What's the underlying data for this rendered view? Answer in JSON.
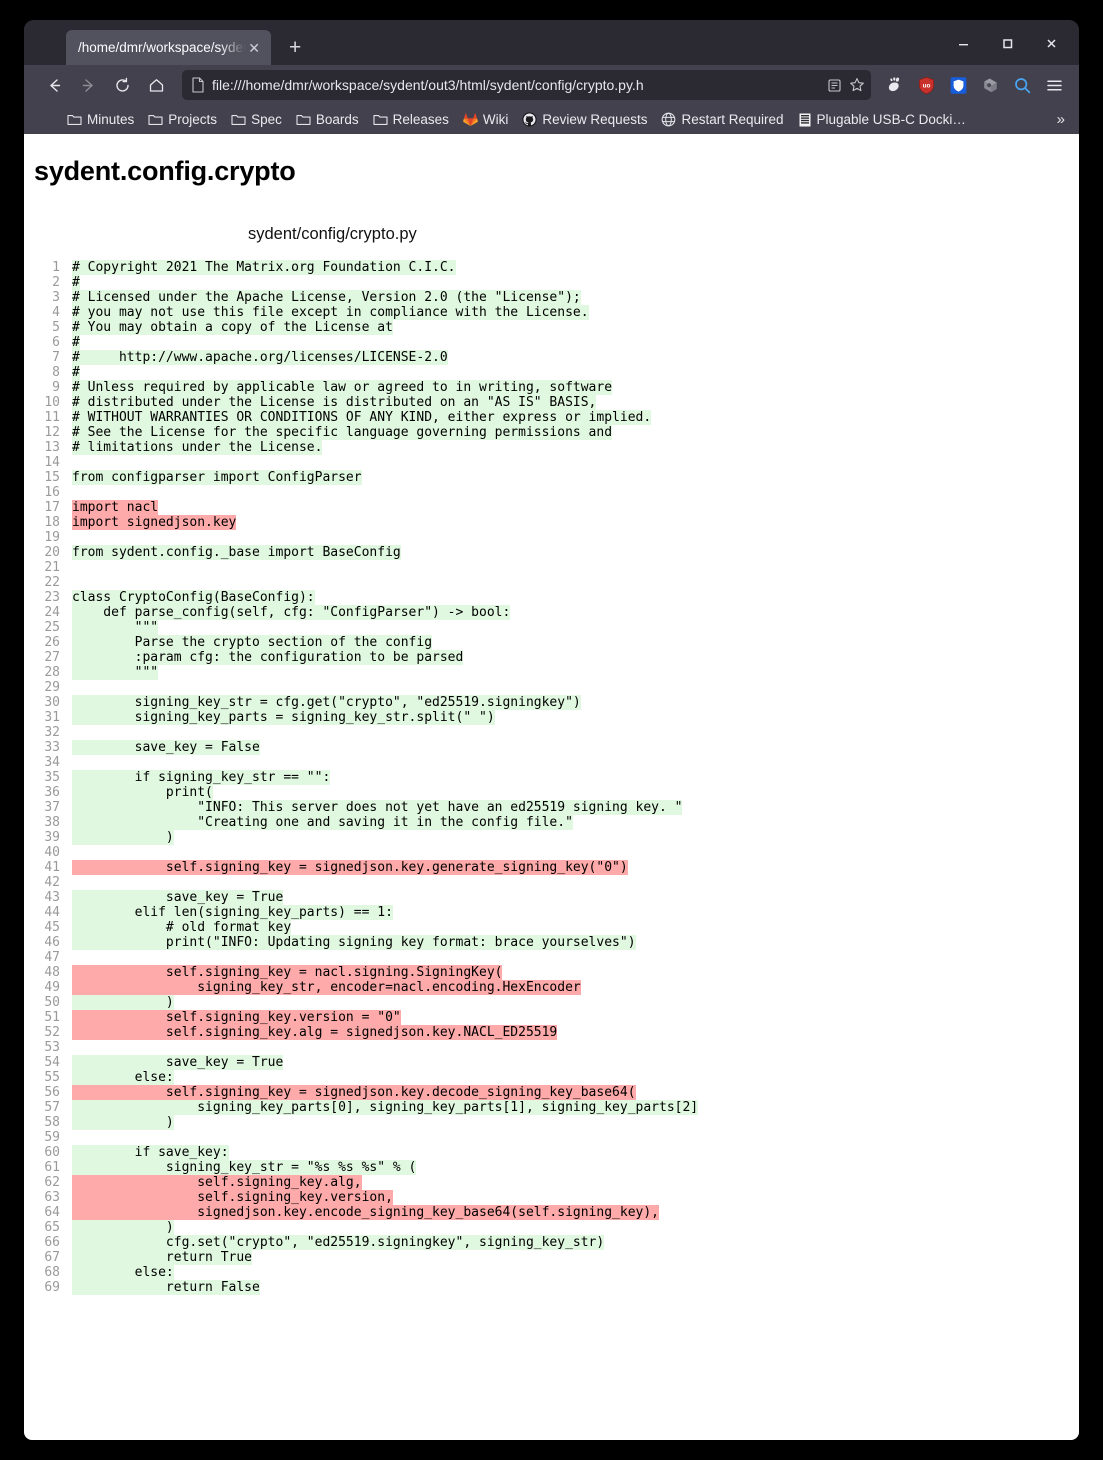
{
  "window": {
    "controls": {
      "minimize": "minimize",
      "maximize": "maximize",
      "close": "close"
    }
  },
  "tabs": [
    {
      "title": "/home/dmr/workspace/syden",
      "close_label": "✕",
      "active": true
    }
  ],
  "new_tab_label": "+",
  "toolbar": {
    "back_label": "back",
    "forward_label": "forward",
    "reload_label": "reload",
    "home_label": "home",
    "url": "file:///home/dmr/workspace/sydent/out3/html/sydent/config/crypto.py.h",
    "reader_label": "reader-view",
    "bookmark_label": "bookmark",
    "extensions": [
      "gnome-icon",
      "ublock-origin-icon",
      "bitwarden-icon",
      "extension-icon"
    ],
    "search_label": "search",
    "menu_label": "menu"
  },
  "bookmarks": {
    "items": [
      {
        "label": "Minutes",
        "icon": "folder-icon"
      },
      {
        "label": "Projects",
        "icon": "folder-icon"
      },
      {
        "label": "Spec",
        "icon": "folder-icon"
      },
      {
        "label": "Boards",
        "icon": "folder-icon"
      },
      {
        "label": "Releases",
        "icon": "folder-icon"
      },
      {
        "label": "Wiki",
        "icon": "gitlab-icon"
      },
      {
        "label": "Review Requests",
        "icon": "github-icon"
      },
      {
        "label": "Restart Required",
        "icon": "globe-icon"
      },
      {
        "label": "Plugable USB-C Docki…",
        "icon": "favicon-icon"
      }
    ],
    "overflow_label": "»"
  },
  "page": {
    "title": "sydent.config.crypto",
    "file_path": "sydent/config/crypto.py",
    "colors": {
      "covered": "#e0f8e0",
      "uncovered": "#ffaaaa"
    },
    "lines": [
      {
        "n": 1,
        "hl": "green",
        "text": "# Copyright 2021 The Matrix.org Foundation C.I.C."
      },
      {
        "n": 2,
        "hl": "green",
        "text": "#"
      },
      {
        "n": 3,
        "hl": "green",
        "text": "# Licensed under the Apache License, Version 2.0 (the \"License\");"
      },
      {
        "n": 4,
        "hl": "green",
        "text": "# you may not use this file except in compliance with the License."
      },
      {
        "n": 5,
        "hl": "green",
        "text": "# You may obtain a copy of the License at"
      },
      {
        "n": 6,
        "hl": "green",
        "text": "#"
      },
      {
        "n": 7,
        "hl": "green",
        "text": "#     http://www.apache.org/licenses/LICENSE-2.0"
      },
      {
        "n": 8,
        "hl": "green",
        "text": "#"
      },
      {
        "n": 9,
        "hl": "green",
        "text": "# Unless required by applicable law or agreed to in writing, software"
      },
      {
        "n": 10,
        "hl": "green",
        "text": "# distributed under the License is distributed on an \"AS IS\" BASIS,"
      },
      {
        "n": 11,
        "hl": "green",
        "text": "# WITHOUT WARRANTIES OR CONDITIONS OF ANY KIND, either express or implied."
      },
      {
        "n": 12,
        "hl": "green",
        "text": "# See the License for the specific language governing permissions and"
      },
      {
        "n": 13,
        "hl": "green",
        "text": "# limitations under the License."
      },
      {
        "n": 14,
        "hl": "none",
        "text": ""
      },
      {
        "n": 15,
        "hl": "green",
        "text": "from configparser import ConfigParser"
      },
      {
        "n": 16,
        "hl": "none",
        "text": ""
      },
      {
        "n": 17,
        "hl": "red",
        "text": "import nacl"
      },
      {
        "n": 18,
        "hl": "red",
        "text": "import signedjson.key"
      },
      {
        "n": 19,
        "hl": "none",
        "text": ""
      },
      {
        "n": 20,
        "hl": "green",
        "text": "from sydent.config._base import BaseConfig"
      },
      {
        "n": 21,
        "hl": "none",
        "text": ""
      },
      {
        "n": 22,
        "hl": "none",
        "text": ""
      },
      {
        "n": 23,
        "hl": "green",
        "text": "class CryptoConfig(BaseConfig):"
      },
      {
        "n": 24,
        "hl": "green",
        "text": "    def parse_config(self, cfg: \"ConfigParser\") -> bool:"
      },
      {
        "n": 25,
        "hl": "green",
        "text": "        \"\"\""
      },
      {
        "n": 26,
        "hl": "green",
        "text": "        Parse the crypto section of the config"
      },
      {
        "n": 27,
        "hl": "green",
        "text": "        :param cfg: the configuration to be parsed"
      },
      {
        "n": 28,
        "hl": "green",
        "text": "        \"\"\""
      },
      {
        "n": 29,
        "hl": "none",
        "text": ""
      },
      {
        "n": 30,
        "hl": "green",
        "text": "        signing_key_str = cfg.get(\"crypto\", \"ed25519.signingkey\")"
      },
      {
        "n": 31,
        "hl": "green",
        "text": "        signing_key_parts = signing_key_str.split(\" \")"
      },
      {
        "n": 32,
        "hl": "none",
        "text": ""
      },
      {
        "n": 33,
        "hl": "green",
        "text": "        save_key = False"
      },
      {
        "n": 34,
        "hl": "none",
        "text": ""
      },
      {
        "n": 35,
        "hl": "green",
        "text": "        if signing_key_str == \"\":"
      },
      {
        "n": 36,
        "hl": "green",
        "text": "            print("
      },
      {
        "n": 37,
        "hl": "green",
        "text": "                \"INFO: This server does not yet have an ed25519 signing key. \""
      },
      {
        "n": 38,
        "hl": "green",
        "text": "                \"Creating one and saving it in the config file.\""
      },
      {
        "n": 39,
        "hl": "green",
        "text": "            )"
      },
      {
        "n": 40,
        "hl": "none",
        "text": ""
      },
      {
        "n": 41,
        "hl": "red",
        "text": "            self.signing_key = signedjson.key.generate_signing_key(\"0\")"
      },
      {
        "n": 42,
        "hl": "none",
        "text": ""
      },
      {
        "n": 43,
        "hl": "green",
        "text": "            save_key = True"
      },
      {
        "n": 44,
        "hl": "green",
        "text": "        elif len(signing_key_parts) == 1:"
      },
      {
        "n": 45,
        "hl": "green",
        "text": "            # old format key"
      },
      {
        "n": 46,
        "hl": "green",
        "text": "            print(\"INFO: Updating signing key format: brace yourselves\")"
      },
      {
        "n": 47,
        "hl": "none",
        "text": ""
      },
      {
        "n": 48,
        "hl": "red",
        "text": "            self.signing_key = nacl.signing.SigningKey("
      },
      {
        "n": 49,
        "hl": "red",
        "text": "                signing_key_str, encoder=nacl.encoding.HexEncoder"
      },
      {
        "n": 50,
        "hl": "green",
        "text": "            )"
      },
      {
        "n": 51,
        "hl": "red",
        "text": "            self.signing_key.version = \"0\""
      },
      {
        "n": 52,
        "hl": "red",
        "text": "            self.signing_key.alg = signedjson.key.NACL_ED25519"
      },
      {
        "n": 53,
        "hl": "none",
        "text": ""
      },
      {
        "n": 54,
        "hl": "green",
        "text": "            save_key = True"
      },
      {
        "n": 55,
        "hl": "green",
        "text": "        else:"
      },
      {
        "n": 56,
        "hl": "red",
        "text": "            self.signing_key = signedjson.key.decode_signing_key_base64("
      },
      {
        "n": 57,
        "hl": "green",
        "text": "                signing_key_parts[0], signing_key_parts[1], signing_key_parts[2]"
      },
      {
        "n": 58,
        "hl": "green",
        "text": "            )"
      },
      {
        "n": 59,
        "hl": "none",
        "text": ""
      },
      {
        "n": 60,
        "hl": "green",
        "text": "        if save_key:"
      },
      {
        "n": 61,
        "hl": "green",
        "text": "            signing_key_str = \"%s %s %s\" % ("
      },
      {
        "n": 62,
        "hl": "red",
        "text": "                self.signing_key.alg,"
      },
      {
        "n": 63,
        "hl": "red",
        "text": "                self.signing_key.version,"
      },
      {
        "n": 64,
        "hl": "red",
        "text": "                signedjson.key.encode_signing_key_base64(self.signing_key),"
      },
      {
        "n": 65,
        "hl": "green",
        "text": "            )"
      },
      {
        "n": 66,
        "hl": "green",
        "text": "            cfg.set(\"crypto\", \"ed25519.signingkey\", signing_key_str)"
      },
      {
        "n": 67,
        "hl": "green",
        "text": "            return True"
      },
      {
        "n": 68,
        "hl": "green",
        "text": "        else:"
      },
      {
        "n": 69,
        "hl": "green",
        "text": "            return False"
      }
    ]
  }
}
